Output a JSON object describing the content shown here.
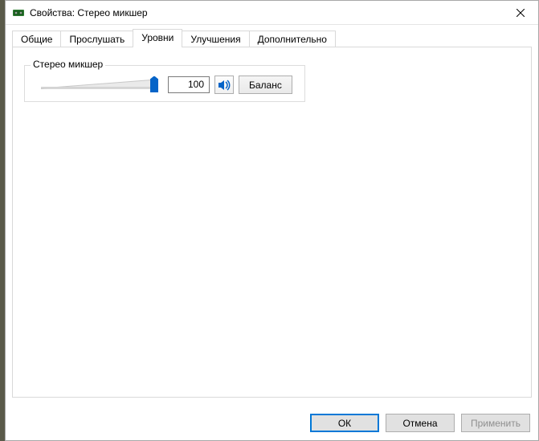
{
  "window": {
    "title": "Свойства: Стерео микшер"
  },
  "tabs": {
    "items": [
      {
        "label": "Общие"
      },
      {
        "label": "Прослушать"
      },
      {
        "label": "Уровни"
      },
      {
        "label": "Улучшения"
      },
      {
        "label": "Дополнительно"
      }
    ],
    "active_index": 2
  },
  "levels": {
    "group_label": "Стерео микшер",
    "value": "100",
    "balance_label": "Баланс"
  },
  "buttons": {
    "ok": "ОК",
    "cancel": "Отмена",
    "apply": "Применить"
  }
}
